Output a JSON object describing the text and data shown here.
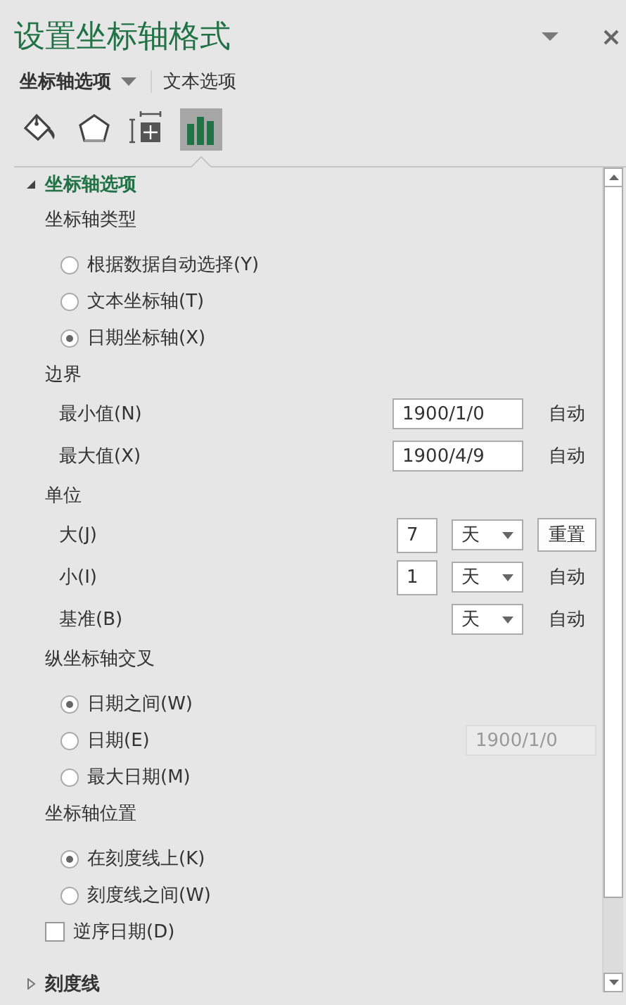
{
  "title": "设置坐标轴格式",
  "tabs": [
    {
      "label": "坐标轴选项",
      "selected": true,
      "dropdown": true
    },
    {
      "label": "文本选项",
      "selected": false,
      "dropdown": false
    }
  ],
  "icon_tabs": [
    {
      "kind": "fill",
      "selected": false
    },
    {
      "kind": "effects",
      "selected": false
    },
    {
      "kind": "size",
      "selected": false
    },
    {
      "kind": "options",
      "selected": true
    }
  ],
  "sections": [
    {
      "title": "坐标轴选项",
      "expanded": true,
      "items": [
        {
          "kind": "heading",
          "label": "坐标轴类型"
        },
        {
          "kind": "radio",
          "label": "根据数据自动选择(Y)",
          "selected": false
        },
        {
          "kind": "radio",
          "label": "文本坐标轴(T)",
          "selected": false
        },
        {
          "kind": "radio",
          "label": "日期坐标轴(X)",
          "selected": true
        },
        {
          "kind": "heading",
          "label": "边界"
        },
        {
          "kind": "field",
          "label": "最小值(N)",
          "value": "1900/1/0",
          "action": {
            "kind": "text",
            "label": "自动"
          }
        },
        {
          "kind": "field",
          "label": "最大值(X)",
          "value": "1900/4/9",
          "action": {
            "kind": "text",
            "label": "自动"
          }
        },
        {
          "kind": "heading",
          "label": "单位"
        },
        {
          "kind": "unit",
          "label": "大(J)",
          "value": "7",
          "unit": "天",
          "action": {
            "kind": "button",
            "label": "重置"
          }
        },
        {
          "kind": "unit",
          "label": "小(I)",
          "value": "1",
          "unit": "天",
          "action": {
            "kind": "text",
            "label": "自动"
          }
        },
        {
          "kind": "unit",
          "label": "基准(B)",
          "unit": "天",
          "action": {
            "kind": "text",
            "label": "自动"
          }
        },
        {
          "kind": "heading",
          "label": "纵坐标轴交叉"
        },
        {
          "kind": "radio",
          "label": "日期之间(W)",
          "selected": true
        },
        {
          "kind": "radio",
          "label": "日期(E)",
          "selected": false,
          "field": {
            "value": "1900/1/0",
            "disabled": true
          }
        },
        {
          "kind": "radio",
          "label": "最大日期(M)",
          "selected": false
        },
        {
          "kind": "heading",
          "label": "坐标轴位置"
        },
        {
          "kind": "radio",
          "label": "在刻度线上(K)",
          "selected": true
        },
        {
          "kind": "radio",
          "label": "刻度线之间(W)",
          "selected": false
        },
        {
          "kind": "checkbox",
          "label": "逆序日期(D)",
          "checked": false
        }
      ]
    },
    {
      "title": "刻度线",
      "expanded": false
    }
  ]
}
